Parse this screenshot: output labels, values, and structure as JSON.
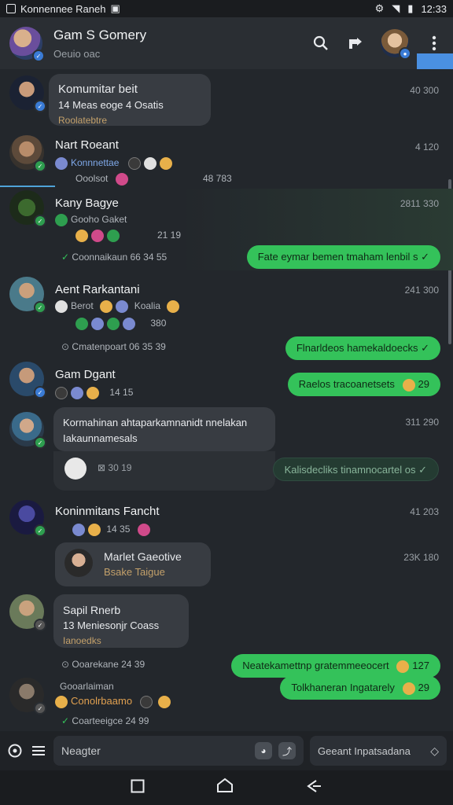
{
  "status_bar": {
    "left_text": "Konnennee Raneh",
    "time": "12:33"
  },
  "header": {
    "title": "Gam S Gomery",
    "subtitle": "Oeuio oac"
  },
  "messages": [
    {
      "name": "Komumitar beit",
      "ts": "40 300",
      "bubble_line1": "14 Meas eoge  4 Osatis",
      "bubble_line2": "Roolatebtre"
    },
    {
      "name": "Nart Roeant",
      "ts": "4 120",
      "sub_line": "Konnnettae",
      "sub_line2": "Ooolsot",
      "sub_ts": "48 783"
    },
    {
      "name": "Kany Bagye",
      "ts": "2811 330",
      "sub_line": "Gooho Gaket",
      "sub_meta": "21 19",
      "meta": "Coonnaikaun 66 34 55",
      "reply": "Fate eymar bemen tmaham lenbil s ✓"
    },
    {
      "name": "Aent Rarkantani",
      "ts": "241 300",
      "sub_line": "Berot",
      "sub_line2": "Koalia",
      "sub_meta": "380",
      "meta": "Cmatenpoart 06 35 39",
      "reply": "Flnarldeos hamekaldoecks ✓"
    },
    {
      "name": "Gam Dgant",
      "ts": "",
      "sub_meta": "14 15",
      "reply": "Raelos tracoanetsets",
      "reply_num": "29"
    },
    {
      "name": "",
      "ts": "311 290",
      "bubble_line1": "Kormahinan ahtaparkamnanidt  nnelakan",
      "bubble_line2": "Iakaunnamesals",
      "meta": "30 19",
      "reply": "Kalisdecliks tinamnocartel os ✓"
    },
    {
      "name": "Koninmitans Fancht",
      "ts": "41 203",
      "sub_meta": "14 35",
      "card_name": "Marlet Gaeotive",
      "card_line": "Bsake  Taigue",
      "card_ts": "23K 180"
    },
    {
      "name": "Sapil Rnerb",
      "bubble_line1": "13 Meniesonjr  Coass",
      "bubble_line2": "Ianoedks",
      "meta": "Ooarekane 24 39",
      "reply": "Neatekamettnp gratemmeeocert",
      "reply_num": "127"
    },
    {
      "name": "Gooarlaiman",
      "sub_line": "Conolrbaamo",
      "meta": "Coarteeigce 24 99",
      "reply": "Tolkhaneran Ingatarely",
      "reply_num": "29"
    }
  ],
  "composer": {
    "placeholder": "Neagter",
    "search_placeholder": "Geeant Inpatsadana"
  }
}
